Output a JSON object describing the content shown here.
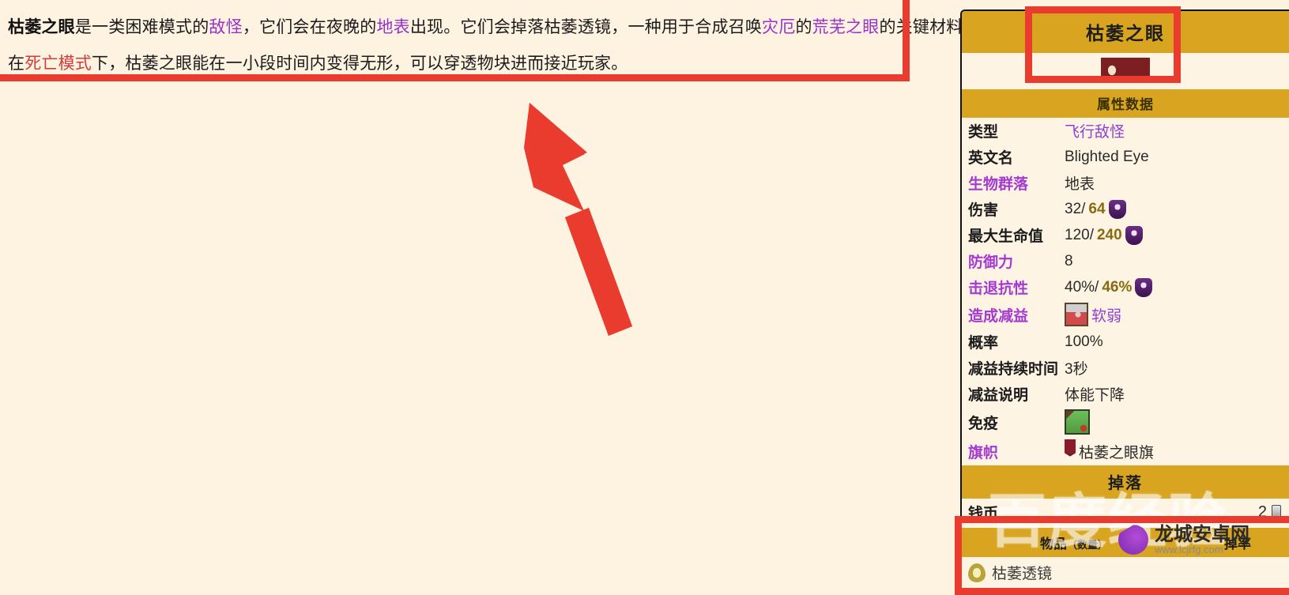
{
  "intro": {
    "line1_seg1": "枯萎之眼",
    "line1_seg2": "是一类困难模式的",
    "line1_link1": "敌怪",
    "line1_seg3": "，它们会在夜晚的",
    "line1_link2": "地表",
    "line1_seg4": "出现。它们会掉落枯萎透镜，一种用于合成召唤",
    "line1_link3": "灾厄",
    "line1_seg5": "的",
    "line1_link4": "荒芜之眼",
    "line1_seg6": "的关键材料。",
    "line2_seg1": "在",
    "line2_link1": "死亡模式",
    "line2_seg2": "下，枯萎之眼能在一小段时间内变得无形，可以穿透物块进而接近玩家。"
  },
  "infobox": {
    "title": "枯萎之眼",
    "sprite_icon": "blighted-eye-sprite",
    "subhead": "属性数据",
    "rows": [
      {
        "key": "类型",
        "key_link": false,
        "value": "飞行敌怪",
        "value_link": true
      },
      {
        "key": "英文名",
        "key_link": false,
        "value": "Blighted Eye",
        "value_link": false
      },
      {
        "key": "生物群落",
        "key_link": true,
        "value": "地表",
        "value_link": false
      },
      {
        "key": "伤害",
        "key_link": false,
        "value_normal": "32/",
        "value_bold": "64",
        "icon": "expert-mode-head-icon"
      },
      {
        "key": "最大生命值",
        "key_link": false,
        "value_normal": "120/",
        "value_bold": "240",
        "icon": "expert-mode-head-icon"
      },
      {
        "key": "防御力",
        "key_link": true,
        "value": "8",
        "value_link": false
      },
      {
        "key": "击退抗性",
        "key_link": true,
        "value_normal": "40%/",
        "value_bold": "46%",
        "icon": "expert-mode-head-icon"
      },
      {
        "key": "造成减益",
        "key_link": true,
        "value": "软弱",
        "value_link": true,
        "icon": "weak-debuff-icon"
      },
      {
        "key": "概率",
        "key_link": false,
        "value": "100%",
        "value_link": false
      },
      {
        "key": "减益持续时间",
        "key_link": false,
        "value": "3秒",
        "value_link": false
      },
      {
        "key": "减益说明",
        "key_link": false,
        "value": "体能下降",
        "value_link": false
      },
      {
        "key": "免疫",
        "key_link": false,
        "value": "",
        "icon": "poisoned-immune-icon"
      },
      {
        "key": "旗帜",
        "key_link": true,
        "value": "枯萎之眼旗",
        "value_link": false,
        "icon": "banner-icon"
      }
    ],
    "drops_header": "掉落",
    "coins_label": "钱币",
    "coins_value": "2",
    "coins_icon": "silver-coin-icon",
    "drop_table": {
      "col_item": "物品",
      "col_item_qty": "（数量）",
      "col_rate": "掉率",
      "rows": [
        {
          "icon": "blighted-lens-icon",
          "name": "枯萎透镜",
          "rate": ""
        }
      ]
    }
  },
  "annotations": {
    "arrow": "red-arrow-pointing-up-left",
    "box_intro": "red-highlight-box-intro",
    "box_title": "red-highlight-box-title",
    "box_drop": "red-highlight-box-drop"
  },
  "watermarks": {
    "baidu_text": "百度经验",
    "site_name": "龙城安卓网",
    "site_url": "www.lcjrfg.com"
  },
  "colors": {
    "page_bg": "#fdf3e0",
    "annotation_red": "#ea3b2f",
    "infobox_gold": "#d9a521",
    "link_purple": "#9b30c9",
    "link_red": "#d63b3b"
  }
}
